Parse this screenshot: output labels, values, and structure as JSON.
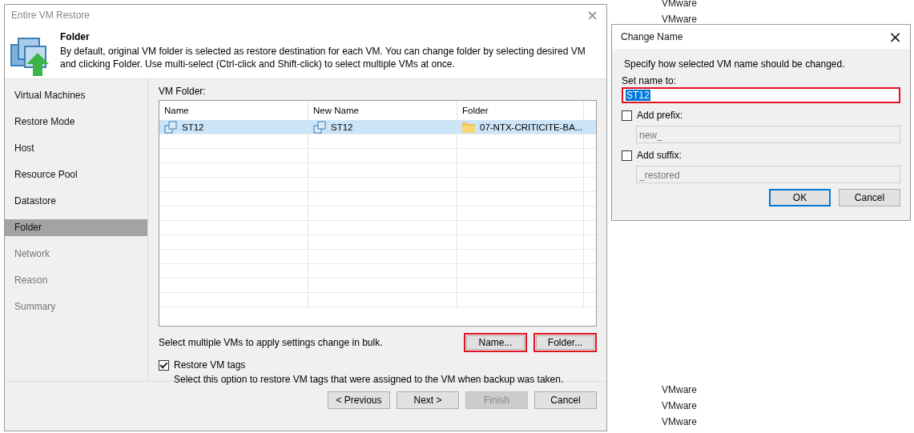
{
  "background": {
    "column_top": [
      "VMware",
      "VMware"
    ],
    "column_bottom": [
      "VMware",
      "VMware",
      "VMware"
    ]
  },
  "wizard": {
    "title": "Entire VM Restore",
    "close": "×",
    "header": {
      "title": "Folder",
      "description": "By default, original VM folder is selected as restore destination for each VM. You can change folder by selecting desired VM and clicking Folder. Use multi-select (Ctrl-click and Shift-click) to select multiple VMs at once."
    },
    "steps": [
      {
        "label": "Virtual Machines",
        "selected": false,
        "disabled": false
      },
      {
        "label": "Restore Mode",
        "selected": false,
        "disabled": false
      },
      {
        "label": "Host",
        "selected": false,
        "disabled": false
      },
      {
        "label": "Resource Pool",
        "selected": false,
        "disabled": false
      },
      {
        "label": "Datastore",
        "selected": false,
        "disabled": false
      },
      {
        "label": "Folder",
        "selected": true,
        "disabled": false
      },
      {
        "label": "Network",
        "selected": false,
        "disabled": true
      },
      {
        "label": "Reason",
        "selected": false,
        "disabled": true
      },
      {
        "label": "Summary",
        "selected": false,
        "disabled": true
      }
    ],
    "table": {
      "label": "VM Folder:",
      "columns": [
        "Name",
        "New Name",
        "Folder"
      ],
      "rows": [
        {
          "selected": true,
          "cells": [
            "ST12",
            "ST12",
            "07-NTX-CRITICITE-BA..."
          ]
        }
      ]
    },
    "bulk_hint": "Select multiple VMs to apply settings change in bulk.",
    "bulk_buttons": [
      {
        "label": "Name...",
        "highlighted": true
      },
      {
        "label": "Folder...",
        "highlighted": true
      }
    ],
    "restore_tags": {
      "label": "Restore VM tags",
      "checked": true,
      "description": "Select this option to restore VM tags that were assigned to the VM when backup was taken."
    },
    "buttons": [
      {
        "label": "< Previous",
        "disabled": false
      },
      {
        "label": "Next >",
        "disabled": false
      },
      {
        "label": "Finish",
        "disabled": true
      },
      {
        "label": "Cancel",
        "disabled": false
      }
    ]
  },
  "change_name": {
    "title": "Change Name",
    "close": "×",
    "instruction": "Specify how selected VM name should be changed.",
    "set_name": {
      "label": "Set name to:",
      "value": "ST12",
      "highlighted": true
    },
    "options": [
      {
        "label": "Add prefix:",
        "checked": false,
        "field": {
          "value": "new_",
          "disabled": true
        }
      },
      {
        "label": "Add suffix:",
        "checked": false,
        "field": {
          "value": "_restored",
          "disabled": true
        }
      }
    ],
    "buttons": [
      {
        "label": "OK",
        "default": true
      },
      {
        "label": "Cancel",
        "default": false
      }
    ]
  }
}
